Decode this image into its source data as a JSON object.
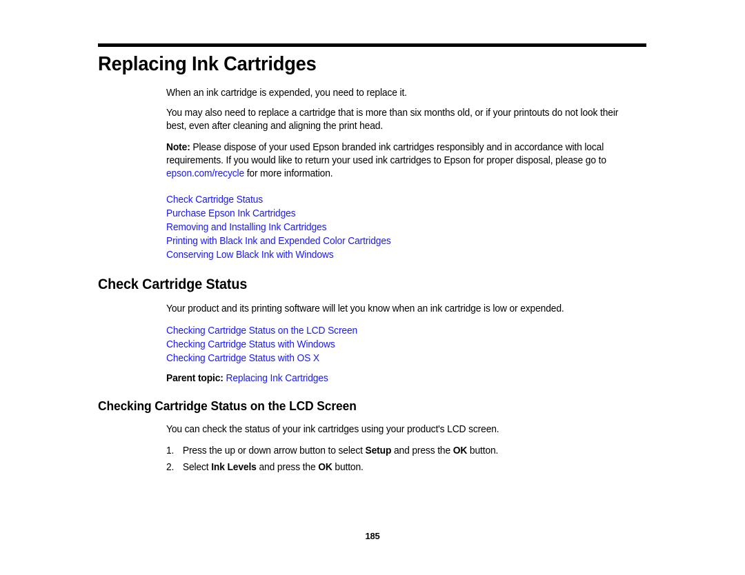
{
  "document": {
    "title": "Replacing Ink Cartridges",
    "page_number": "185",
    "link_color": "#1a1af0",
    "text_color": "#000000",
    "background_color": "#ffffff"
  },
  "intro": {
    "para1": "When an ink cartridge is expended, you need to replace it.",
    "para2": "You may also need to replace a cartridge that is more than six months old, or if your printouts do not look their best, even after cleaning and aligning the print head."
  },
  "note": {
    "label": "Note:",
    "text_before_link": " Please dispose of your used Epson branded ink cartridges responsibly and in accordance with local requirements. If you would like to return your used ink cartridges to Epson for proper disposal, please go to ",
    "link_text": "epson.com/recycle",
    "text_after_link": " for more information."
  },
  "topic_links": [
    {
      "label": "Check Cartridge Status"
    },
    {
      "label": "Purchase Epson Ink Cartridges"
    },
    {
      "label": "Removing and Installing Ink Cartridges"
    },
    {
      "label": "Printing with Black Ink and Expended Color Cartridges"
    },
    {
      "label": "Conserving Low Black Ink with Windows"
    }
  ],
  "section": {
    "heading": "Check Cartridge Status",
    "intro": "Your product and its printing software will let you know when an ink cartridge is low or expended.",
    "links": [
      {
        "label": "Checking Cartridge Status on the LCD Screen"
      },
      {
        "label": "Checking Cartridge Status with Windows"
      },
      {
        "label": "Checking Cartridge Status with OS X"
      }
    ],
    "parent_topic": {
      "label": "Parent topic:",
      "link_text": "Replacing Ink Cartridges"
    }
  },
  "subsection": {
    "heading": "Checking Cartridge Status on the LCD Screen",
    "intro": "You can check the status of your ink cartridges using your product's LCD screen.",
    "steps": [
      {
        "number": "1.",
        "part1": "Press the up or down arrow button to select ",
        "bold1": "Setup",
        "part2": " and press the ",
        "bold2": "OK",
        "part3": " button."
      },
      {
        "number": "2.",
        "part1": "Select ",
        "bold1": "Ink Levels",
        "part2": " and press the ",
        "bold2": "OK",
        "part3": " button."
      }
    ]
  }
}
